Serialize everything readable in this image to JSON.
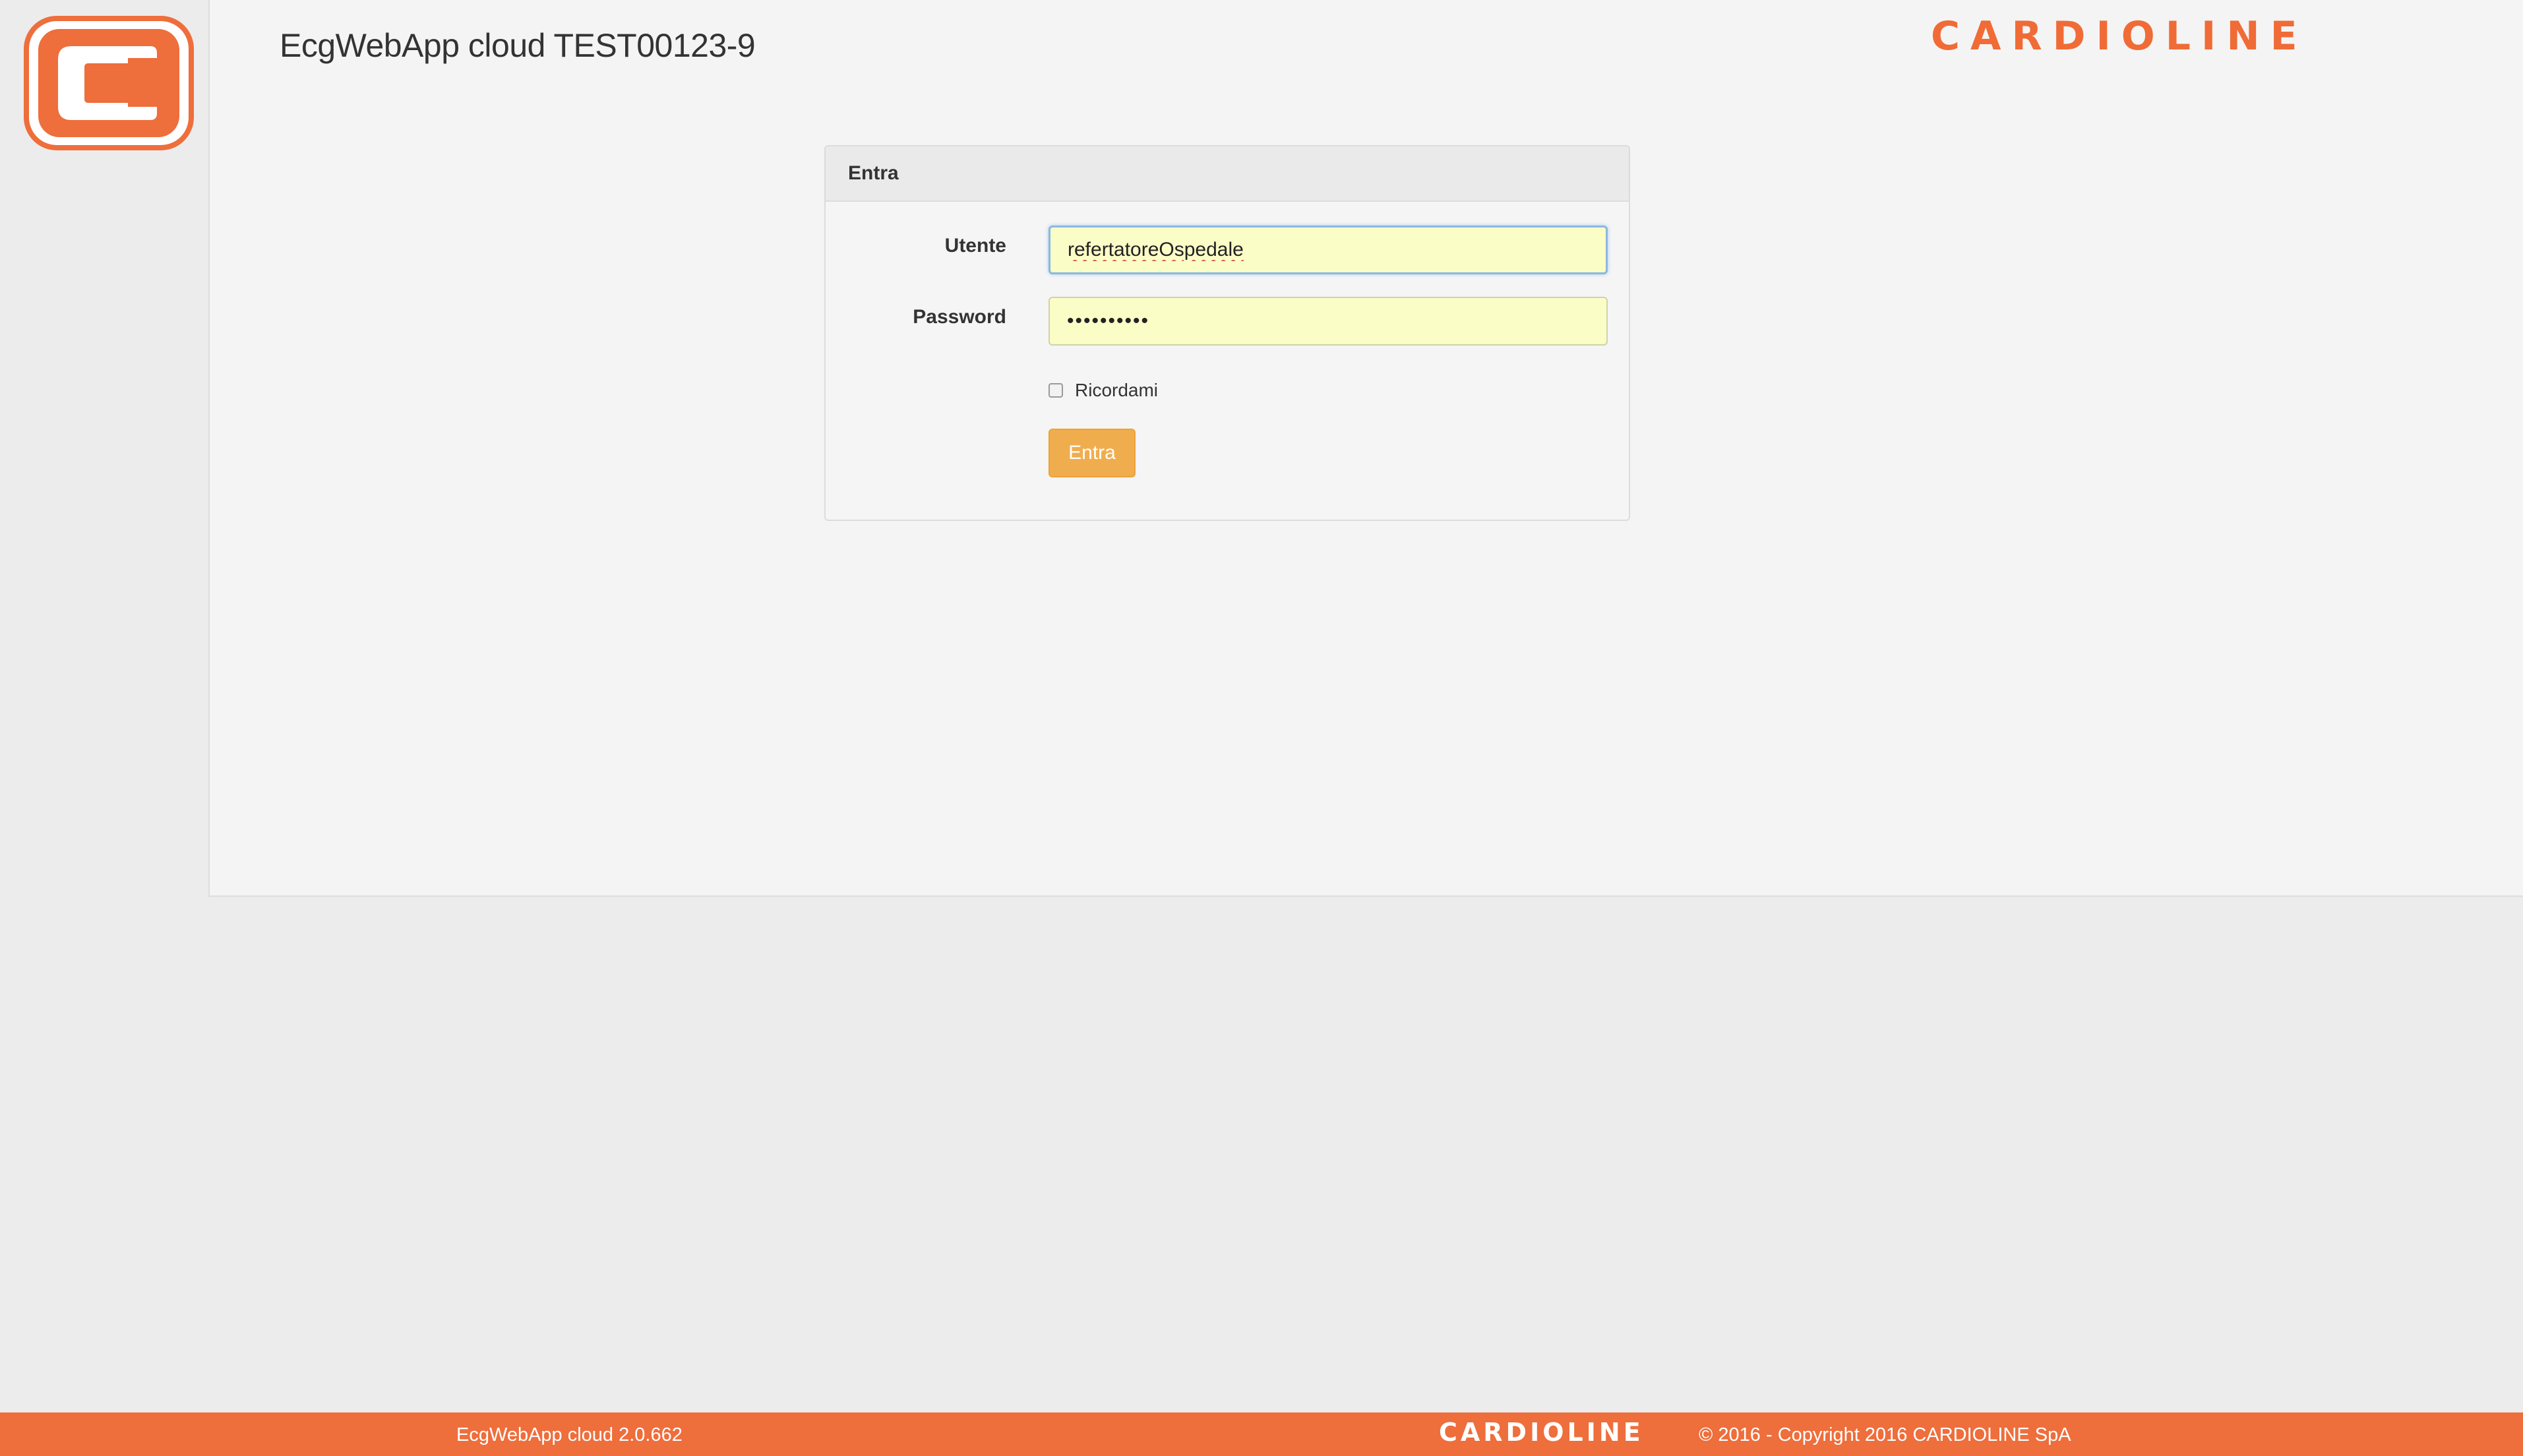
{
  "header": {
    "app_title": "EcgWebApp cloud TEST00123-9",
    "brand_wordmark": "CARDIOLINE",
    "logo_icon": "cardioline-c-logo-icon"
  },
  "login_panel": {
    "heading": "Entra",
    "username_label": "Utente",
    "username_value": "refertatoreOspedale",
    "password_label": "Password",
    "password_value": "••••••••••",
    "remember_label": "Ricordami",
    "remember_checked": false,
    "submit_label": "Entra"
  },
  "footer": {
    "version": "EcgWebApp cloud 2.0.662",
    "brand_wordmark": "CARDIOLINE",
    "copyright": "© 2016 - Copyright 2016 CARDIOLINE SpA"
  },
  "colors": {
    "brand_orange": "#ee6e3c",
    "button_warning": "#f0ad4e",
    "autofill_yellow": "#fbfdc6",
    "page_background": "#ececec",
    "content_background": "#f4f4f4"
  }
}
